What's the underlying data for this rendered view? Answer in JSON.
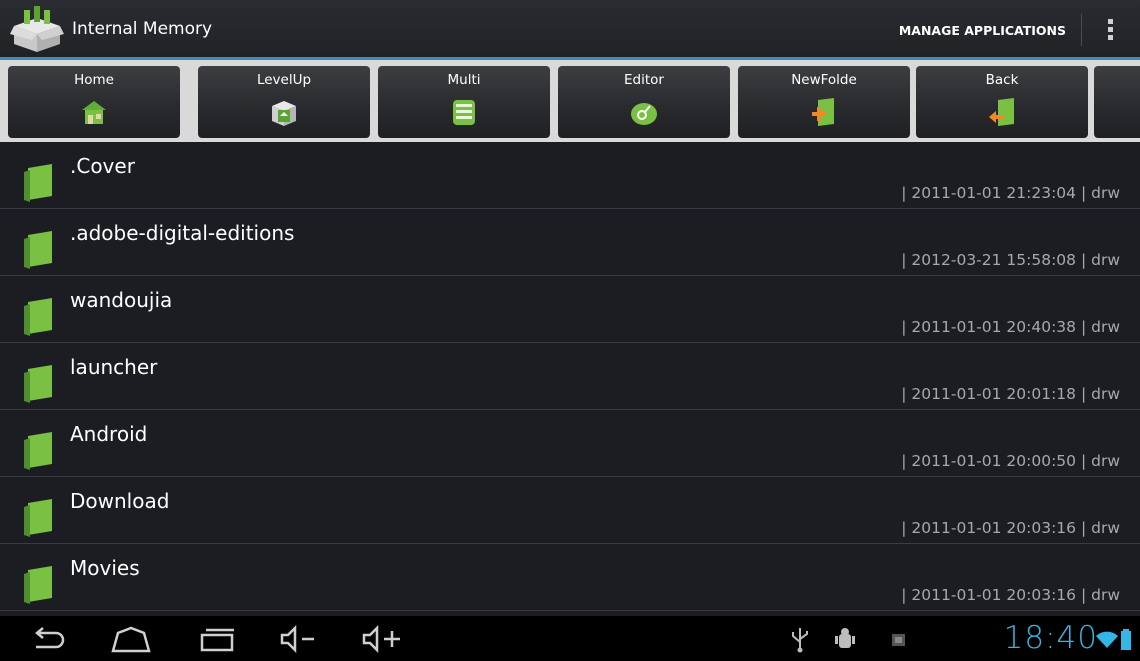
{
  "app": {
    "title": "Internal Memory",
    "manage_label": "MANAGE APPLICATIONS",
    "icon": "app-box-icon",
    "accent": "#3a8fb7"
  },
  "toolbar": {
    "buttons": [
      {
        "label": "Home",
        "icon": "home-icon"
      },
      {
        "label": "LevelUp",
        "icon": "levelup-icon"
      },
      {
        "label": "Multi",
        "icon": "multi-icon"
      },
      {
        "label": "Editor",
        "icon": "editor-icon"
      },
      {
        "label": "NewFolde",
        "icon": "new-folder-icon"
      },
      {
        "label": "Back",
        "icon": "back-icon"
      }
    ]
  },
  "files": [
    {
      "name": ".Cover",
      "meta": "| 2011-01-01 21:23:04 | drw"
    },
    {
      "name": ".adobe-digital-editions",
      "meta": "| 2012-03-21 15:58:08 | drw"
    },
    {
      "name": "wandoujia",
      "meta": "| 2011-01-01 20:40:38 | drw"
    },
    {
      "name": "launcher",
      "meta": "| 2011-01-01 20:01:18 | drw"
    },
    {
      "name": "Android",
      "meta": "| 2011-01-01 20:00:50 | drw"
    },
    {
      "name": "Download",
      "meta": "| 2011-01-01 20:03:16 | drw"
    },
    {
      "name": "Movies",
      "meta": "| 2011-01-01 20:03:16 | drw"
    }
  ],
  "status": {
    "clock": "18:40",
    "clock_color": "#33b5e5",
    "icons": [
      "usb-icon",
      "debug-icon",
      "notification-icon",
      "wifi-icon",
      "battery-icon"
    ]
  },
  "nav": {
    "buttons": [
      "back-nav-icon",
      "home-nav-icon",
      "recent-apps-icon",
      "volume-down-icon",
      "volume-up-icon"
    ]
  }
}
